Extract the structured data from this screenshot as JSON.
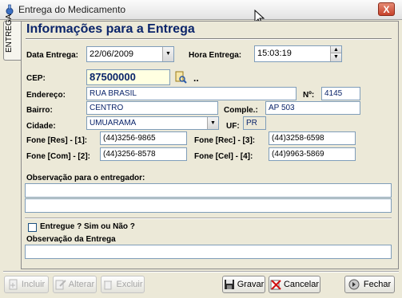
{
  "window": {
    "title": "Entrega do Medicamento",
    "close_label": "X"
  },
  "tab": {
    "label": "ENTREGA"
  },
  "section": {
    "heading": "Informações para a Entrega"
  },
  "delivery_date": {
    "label": "Data Entrega:",
    "value": "22/06/2009"
  },
  "delivery_time": {
    "label": "Hora Entrega:",
    "value": "15:03:19"
  },
  "cep": {
    "label": "CEP:",
    "value": "87500000",
    "extra": ".."
  },
  "address": {
    "label": "Endereço:",
    "value": "RUA BRASIL"
  },
  "number": {
    "label": "Nº:",
    "value": "4145"
  },
  "district": {
    "label": "Bairro:",
    "value": "CENTRO"
  },
  "complement": {
    "label": "Comple.:",
    "value": "AP 503"
  },
  "city": {
    "label": "Cidade:",
    "value": "UMUARAMA"
  },
  "state": {
    "label": "UF:",
    "value": "PR"
  },
  "phone_res": {
    "label": "Fone [Res] - [1]:",
    "value": "(44)3256-9865"
  },
  "phone_rec": {
    "label": "Fone [Rec] - [3]:",
    "value": "(44)3258-6598"
  },
  "phone_com": {
    "label": "Fone [Com] - [2]:",
    "value": "(44)3256-8578"
  },
  "phone_cel": {
    "label": "Fone [Cel] - [4]:",
    "value": "(44)9963-5869"
  },
  "courier_note": {
    "label": "Observação para o entregador:",
    "line1": "",
    "line2": ""
  },
  "delivered": {
    "label": "Entregue ? Sim ou Não ?"
  },
  "delivery_note": {
    "label": "Observação da Entrega",
    "value": ""
  },
  "buttons": {
    "incluir": "Incluir",
    "alterar": "Alterar",
    "excluir": "Excluir",
    "gravar": "Gravar",
    "cancelar": "Cancelar",
    "fechar": "Fechar"
  }
}
